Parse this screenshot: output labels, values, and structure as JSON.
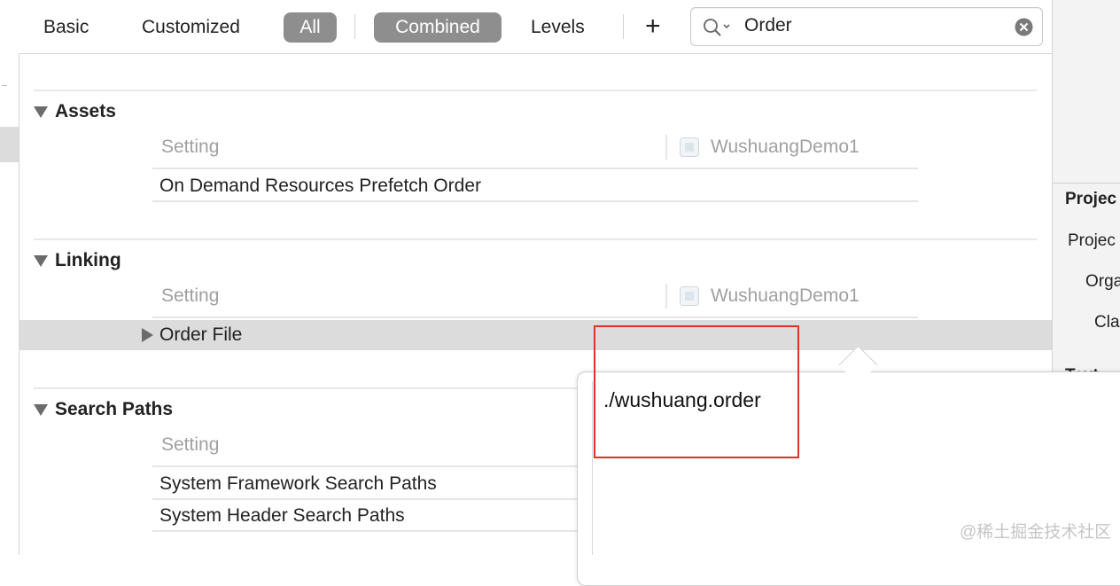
{
  "toolbar": {
    "basic": "Basic",
    "customized": "Customized",
    "all": "All",
    "combined": "Combined",
    "levels": "Levels",
    "add": "+",
    "search_value": "Order"
  },
  "sections": {
    "assets": {
      "title": "Assets",
      "setting_header": "Setting",
      "target": "WushuangDemo1",
      "row": "On Demand Resources Prefetch Order"
    },
    "linking": {
      "title": "Linking",
      "setting_header": "Setting",
      "target": "WushuangDemo1",
      "row": "Order File"
    },
    "search_paths": {
      "title": "Search Paths",
      "setting_header": "Setting",
      "rows": [
        "System Framework Search Paths",
        "System Header Search Paths"
      ]
    }
  },
  "popover": {
    "value": "./wushuang.order"
  },
  "right_panel": {
    "header": "Projec",
    "items": [
      "Projec",
      "Orga",
      "Cla",
      "Text"
    ]
  },
  "colors": {
    "highlight": "#e0312a",
    "pill": "#8e8e8e",
    "selected_row": "#dcdcdc"
  },
  "watermark": "@稀土掘金技术社区"
}
